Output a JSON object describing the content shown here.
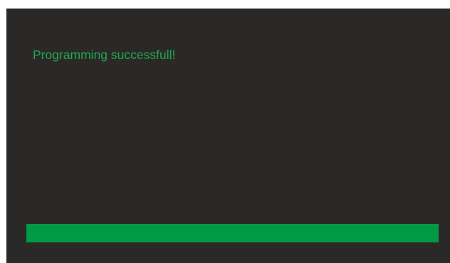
{
  "dialog": {
    "status_message": "Programming successfull!",
    "progress_fraction": 1.0
  },
  "colors": {
    "panel_background": "#2b2927",
    "status_text": "#1fa84e",
    "progress_fill": "#009a44"
  }
}
